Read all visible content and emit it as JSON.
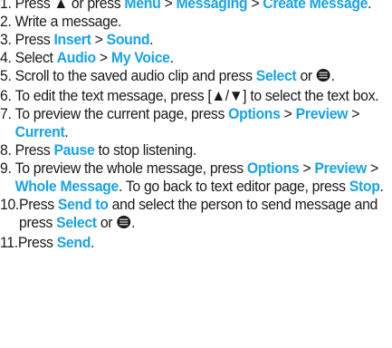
{
  "steps": [
    {
      "num": "1. ",
      "parts": [
        {
          "t": "Press "
        },
        {
          "t": "▲"
        },
        {
          "t": " or press "
        },
        {
          "k": "Menu"
        },
        {
          "t": " > "
        },
        {
          "k": "Messaging"
        },
        {
          "t": " > "
        },
        {
          "k": "Create Message"
        },
        {
          "t": "."
        }
      ]
    },
    {
      "num": "2. ",
      "parts": [
        {
          "t": "Write a message."
        }
      ]
    },
    {
      "num": "3. ",
      "parts": [
        {
          "t": "Press "
        },
        {
          "k": "Insert"
        },
        {
          "t": " > "
        },
        {
          "k": "Sound"
        },
        {
          "t": "."
        }
      ]
    },
    {
      "num": "4. ",
      "parts": [
        {
          "t": "Select "
        },
        {
          "k": "Audio"
        },
        {
          "t": " > "
        },
        {
          "k": "My Voice"
        },
        {
          "t": "."
        }
      ]
    },
    {
      "num": "5. ",
      "parts": [
        {
          "t": "Scroll to the saved audio clip and press "
        },
        {
          "k": "Select"
        },
        {
          "t": " or "
        },
        {
          "i": "center-key-icon"
        },
        {
          "t": "."
        }
      ]
    },
    {
      "num": "6. ",
      "parts": [
        {
          "t": "To edit the text message, press [▲/▼] to select the text box."
        }
      ]
    },
    {
      "num": "7. ",
      "parts": [
        {
          "t": "To preview the current page, press "
        },
        {
          "k": "Options"
        },
        {
          "t": " > "
        },
        {
          "k": "Preview"
        },
        {
          "t": " > "
        },
        {
          "k": "Current"
        },
        {
          "t": "."
        }
      ]
    },
    {
      "num": "8. ",
      "parts": [
        {
          "t": "Press "
        },
        {
          "k": "Pause"
        },
        {
          "t": " to stop listening."
        }
      ]
    },
    {
      "num": "9. ",
      "parts": [
        {
          "t": "To preview the whole message, press "
        },
        {
          "k": "Options"
        },
        {
          "t": " > "
        },
        {
          "k": "Preview"
        },
        {
          "t": " > "
        },
        {
          "k": "Whole Message"
        },
        {
          "t": ". To go back to text editor page, press "
        },
        {
          "k": "Stop"
        },
        {
          "t": "."
        }
      ]
    },
    {
      "num": "10.",
      "parts": [
        {
          "t": "Press "
        },
        {
          "k": "Send to"
        },
        {
          "t": " and select the person to send message and press "
        },
        {
          "k": "Select"
        },
        {
          "t": " or "
        },
        {
          "i": "center-key-icon"
        },
        {
          "t": "."
        }
      ]
    },
    {
      "num": "11.",
      "parts": [
        {
          "t": "Press "
        },
        {
          "k": "Send"
        },
        {
          "t": "."
        }
      ]
    }
  ],
  "colors": {
    "keyword": "#1aa3e8",
    "text": "#1a1a1a"
  }
}
